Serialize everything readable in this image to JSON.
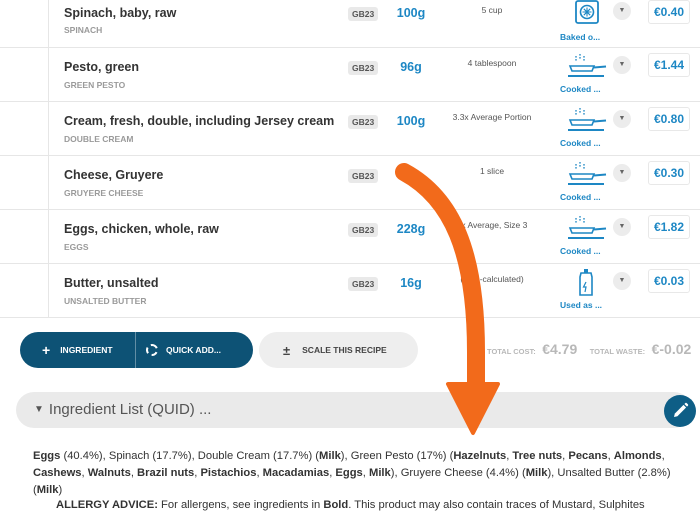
{
  "ingredients": [
    {
      "name": "Spinach, baby, raw",
      "sub": "SPINACH",
      "tag": "GB23",
      "qty": "100g",
      "measure": "5 cup",
      "method": "Baked o...",
      "method_icon": "oven-icon",
      "cost": "€0.40"
    },
    {
      "name": "Pesto, green",
      "sub": "GREEN PESTO",
      "tag": "GB23",
      "qty": "96g",
      "measure": "4 tablespoon",
      "method": "Cooked ...",
      "method_icon": "frying-pan-icon",
      "cost": "€1.44"
    },
    {
      "name": "Cream, fresh, double, including Jersey cream",
      "sub": "DOUBLE CREAM",
      "tag": "GB23",
      "qty": "100g",
      "measure": "3.3x Average Portion",
      "method": "Cooked ...",
      "method_icon": "frying-pan-icon",
      "cost": "€0.80"
    },
    {
      "name": "Cheese, Gruyere",
      "sub": "GRUYERE CHEESE",
      "tag": "GB23",
      "qty": "",
      "measure": "1 slice",
      "method": "Cooked ...",
      "method_icon": "frying-pan-icon",
      "cost": "€0.30"
    },
    {
      "name": "Eggs, chicken, whole, raw",
      "sub": "EGGS",
      "tag": "GB23",
      "qty": "228g",
      "measure": "4x Average, Size 3",
      "method": "Cooked ...",
      "method_icon": "frying-pan-icon",
      "cost": "€1.82"
    },
    {
      "name": "Butter, unsalted",
      "sub": "UNSALTED BUTTER",
      "tag": "GB23",
      "qty": "16g",
      "measure": "(auto-calculated)",
      "method": "Used as ...",
      "method_icon": "spray-bottle-icon",
      "cost": "€0.03"
    }
  ],
  "actions": {
    "ingredient_label": "INGREDIENT",
    "quick_add_label": "QUICK ADD...",
    "scale_label": "SCALE THIS RECIPE",
    "plus_glyph": "+",
    "plusminus_glyph": "±"
  },
  "totals": {
    "cost_label": "TOTAL COST:",
    "cost_value": "€4.79",
    "waste_label": "TOTAL WASTE:",
    "waste_value": "€-0.02"
  },
  "quid": {
    "caret": "▼",
    "title": "Ingredient List (QUID) ...",
    "list": [
      {
        "t": "Eggs",
        "b": true
      },
      {
        "t": " (40.4%), Spinach (17.7%), Double Cream (17.7%) ("
      },
      {
        "t": "Milk",
        "b": true
      },
      {
        "t": "), Green Pesto (17%) ("
      },
      {
        "t": "Hazelnuts",
        "b": true
      },
      {
        "t": ", "
      },
      {
        "t": "Tree nuts",
        "b": true
      },
      {
        "t": ", "
      },
      {
        "t": "Pecans",
        "b": true
      },
      {
        "t": ", "
      },
      {
        "t": "Almonds",
        "b": true
      },
      {
        "t": ", "
      },
      {
        "t": "Cashews",
        "b": true
      },
      {
        "t": ", "
      },
      {
        "t": "Walnuts",
        "b": true
      },
      {
        "t": ", "
      },
      {
        "t": "Brazil nuts",
        "b": true
      },
      {
        "t": ", "
      },
      {
        "t": "Pistachios",
        "b": true
      },
      {
        "t": ", "
      },
      {
        "t": "Macadamias",
        "b": true
      },
      {
        "t": ", "
      },
      {
        "t": "Eggs",
        "b": true
      },
      {
        "t": ", "
      },
      {
        "t": "Milk",
        "b": true
      },
      {
        "t": "), Gruyere Cheese (4.4%) ("
      },
      {
        "t": "Milk",
        "b": true
      },
      {
        "t": "), Unsalted Butter (2.8%) ("
      },
      {
        "t": "Milk",
        "b": true
      },
      {
        "t": ")"
      }
    ],
    "allergy_label": "ALLERGY ADVICE:",
    "allergy_text_1": " For allergens, see ingredients in ",
    "allergy_bold": "Bold",
    "allergy_text_2": ". This product may also contain traces of Mustard, Sulphites"
  },
  "colors": {
    "accent": "#1d87c4",
    "button_dark": "#0d5275",
    "arrow": "#f26a1b"
  }
}
